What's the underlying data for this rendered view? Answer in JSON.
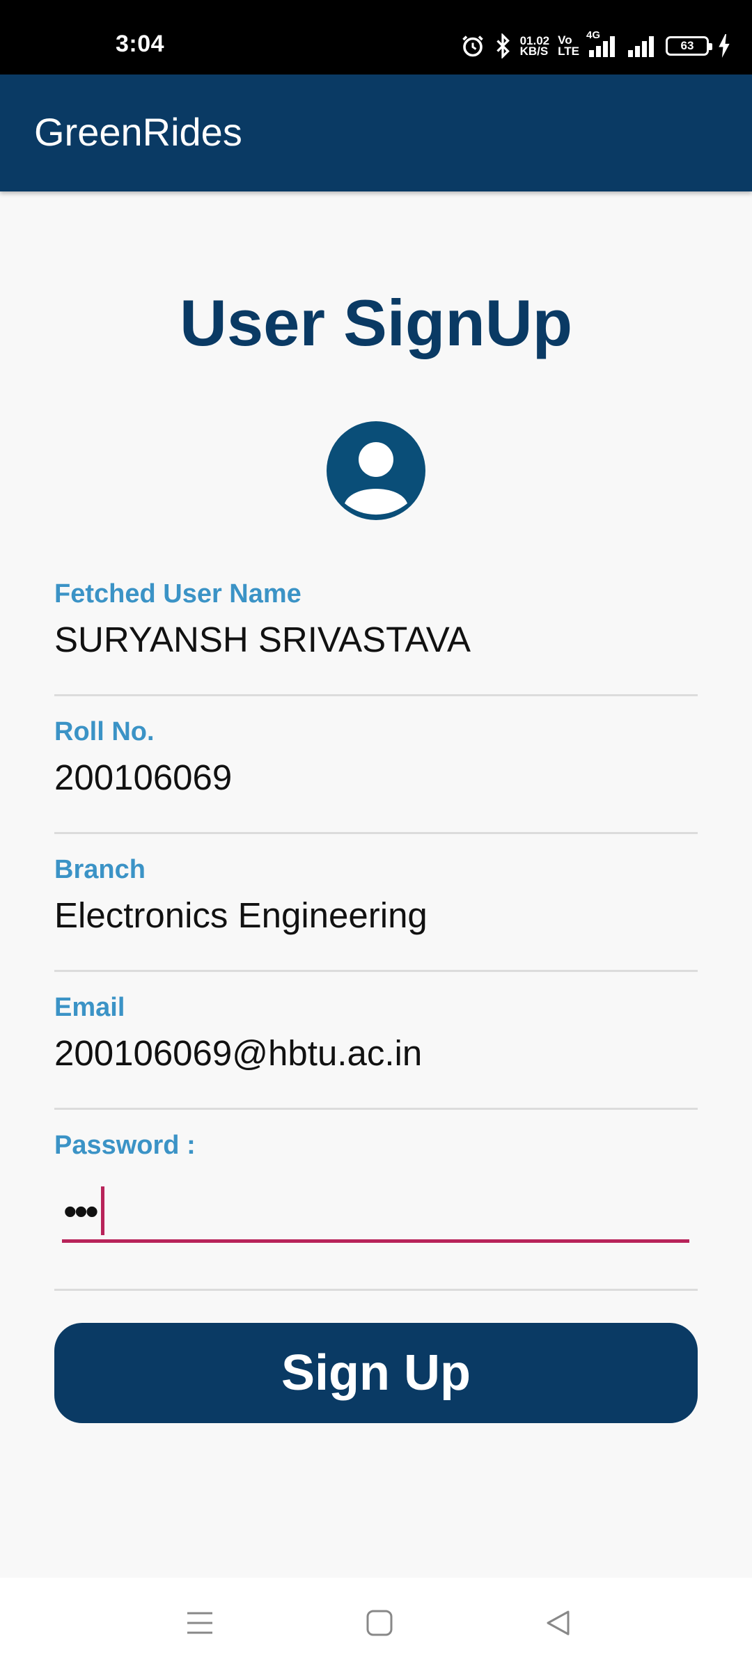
{
  "status_bar": {
    "time": "3:04",
    "net_speed_value": "01.02",
    "net_speed_unit": "KB/S",
    "volte_top": "Vo",
    "volte_bottom": "LTE",
    "network_type": "4G",
    "battery_level": "63",
    "icons": [
      "alarm-icon",
      "bluetooth-icon",
      "signal-icon",
      "signal-icon",
      "battery-icon",
      "charging-icon"
    ]
  },
  "app_bar": {
    "title": "GreenRides"
  },
  "page": {
    "title": "User SignUp",
    "avatar_icon": "user-avatar-icon"
  },
  "fields": {
    "name": {
      "label": "Fetched User Name",
      "value": "SURYANSH SRIVASTAVA"
    },
    "roll": {
      "label": "Roll No.",
      "value": "200106069"
    },
    "branch": {
      "label": "Branch",
      "value": "Electronics Engineering"
    },
    "email": {
      "label": "Email",
      "value": "200106069@hbtu.ac.in"
    },
    "password": {
      "label": "Password :",
      "value": "•••"
    }
  },
  "actions": {
    "signup_label": "Sign Up"
  },
  "nav_bar": {
    "icons": [
      "menu-icon",
      "home-icon",
      "back-icon"
    ]
  },
  "colors": {
    "primary": "#0a3a64",
    "label_blue": "#3b93c6",
    "accent_focus": "#b8245a",
    "background": "#f8f8f8"
  }
}
